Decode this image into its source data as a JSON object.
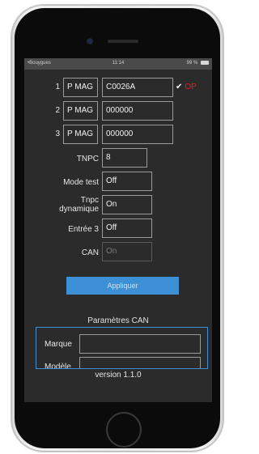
{
  "status_bar": {
    "carrier": "•Bouygues",
    "time": "11:14",
    "battery": "99 %"
  },
  "rows": [
    {
      "number": "1",
      "type": "P MAG",
      "value": "C0026A",
      "check": "✔",
      "status": "OP"
    },
    {
      "number": "2",
      "type": "P MAG",
      "value": "000000"
    },
    {
      "number": "3",
      "type": "P MAG",
      "value": "000000"
    }
  ],
  "settings": {
    "tnpc": {
      "label": "TNPC",
      "value": "8"
    },
    "mode_test": {
      "label": "Mode test",
      "value": "Off"
    },
    "tnpc_dynamique": {
      "label_line1": "Tnpc",
      "label_line2": "dynamique",
      "value": "On"
    },
    "entree3": {
      "label": "Entrée 3",
      "value": "Off"
    },
    "can": {
      "label": "CAN",
      "value": "On"
    }
  },
  "apply_button": "Appliquer",
  "can_section": {
    "title": "Paramètres CAN",
    "marque_label": "Marque",
    "modele_label": "Modèle",
    "marque_value": "",
    "modele_value": ""
  },
  "version": "version 1.1.0",
  "colors": {
    "accent": "#3d8fd6",
    "error": "#e01e1e",
    "background": "#2b2b2b"
  }
}
